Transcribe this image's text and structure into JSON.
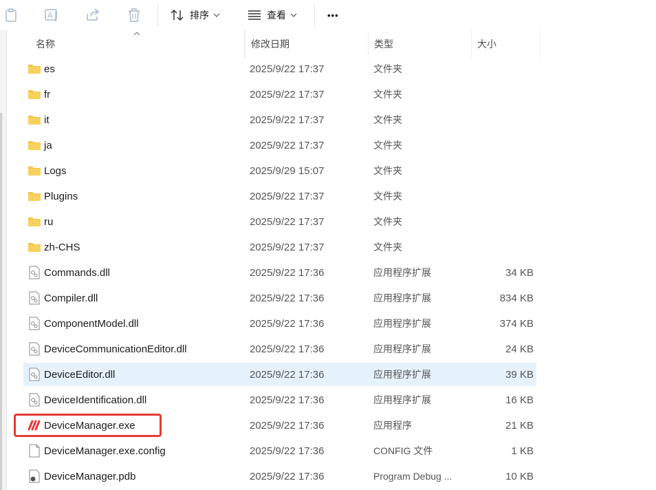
{
  "toolbar": {
    "copy_icon": "clipboard-icon",
    "rename_icon": "rename-icon",
    "share_icon": "share-icon",
    "delete_icon": "trash-icon",
    "sort_label": "排序",
    "view_label": "查看",
    "more_label": "•••"
  },
  "columns": {
    "name": "名称",
    "modified": "修改日期",
    "type": "类型",
    "size": "大小"
  },
  "files": [
    {
      "name": "es",
      "date": "2025/9/22 17:37",
      "type": "文件夹",
      "size": "",
      "icon": "folder-icon"
    },
    {
      "name": "fr",
      "date": "2025/9/22 17:37",
      "type": "文件夹",
      "size": "",
      "icon": "folder-icon"
    },
    {
      "name": "it",
      "date": "2025/9/22 17:37",
      "type": "文件夹",
      "size": "",
      "icon": "folder-icon"
    },
    {
      "name": "ja",
      "date": "2025/9/22 17:37",
      "type": "文件夹",
      "size": "",
      "icon": "folder-icon"
    },
    {
      "name": "Logs",
      "date": "2025/9/29 15:07",
      "type": "文件夹",
      "size": "",
      "icon": "folder-icon"
    },
    {
      "name": "Plugins",
      "date": "2025/9/22 17:37",
      "type": "文件夹",
      "size": "",
      "icon": "folder-icon"
    },
    {
      "name": "ru",
      "date": "2025/9/22 17:37",
      "type": "文件夹",
      "size": "",
      "icon": "folder-icon"
    },
    {
      "name": "zh-CHS",
      "date": "2025/9/22 17:37",
      "type": "文件夹",
      "size": "",
      "icon": "folder-icon"
    },
    {
      "name": "Commands.dll",
      "date": "2025/9/22 17:36",
      "type": "应用程序扩展",
      "size": "34 KB",
      "icon": "dll-icon"
    },
    {
      "name": "Compiler.dll",
      "date": "2025/9/22 17:36",
      "type": "应用程序扩展",
      "size": "834 KB",
      "icon": "dll-icon"
    },
    {
      "name": "ComponentModel.dll",
      "date": "2025/9/22 17:36",
      "type": "应用程序扩展",
      "size": "374 KB",
      "icon": "dll-icon"
    },
    {
      "name": "DeviceCommunicationEditor.dll",
      "date": "2025/9/22 17:36",
      "type": "应用程序扩展",
      "size": "24 KB",
      "icon": "dll-icon"
    },
    {
      "name": "DeviceEditor.dll",
      "date": "2025/9/22 17:36",
      "type": "应用程序扩展",
      "size": "39 KB",
      "icon": "dll-icon"
    },
    {
      "name": "DeviceIdentification.dll",
      "date": "2025/9/22 17:36",
      "type": "应用程序扩展",
      "size": "16 KB",
      "icon": "dll-icon"
    },
    {
      "name": "DeviceManager.exe",
      "date": "2025/9/22 17:36",
      "type": "应用程序",
      "size": "21 KB",
      "icon": "app-logo-icon"
    },
    {
      "name": "DeviceManager.exe.config",
      "date": "2025/9/22 17:36",
      "type": "CONFIG 文件",
      "size": "1 KB",
      "icon": "file-icon"
    },
    {
      "name": "DeviceManager.pdb",
      "date": "2025/9/22 17:36",
      "type": "Program Debug ...",
      "size": "10 KB",
      "icon": "pdb-icon"
    }
  ],
  "selected_row": "DeviceEditor.dll",
  "highlighted_row": "DeviceManager.exe",
  "colors": {
    "folder": "#f4c24a",
    "selection": "#e6f2fb",
    "highlight": "#e53935",
    "exe_logo": "#e53935"
  }
}
